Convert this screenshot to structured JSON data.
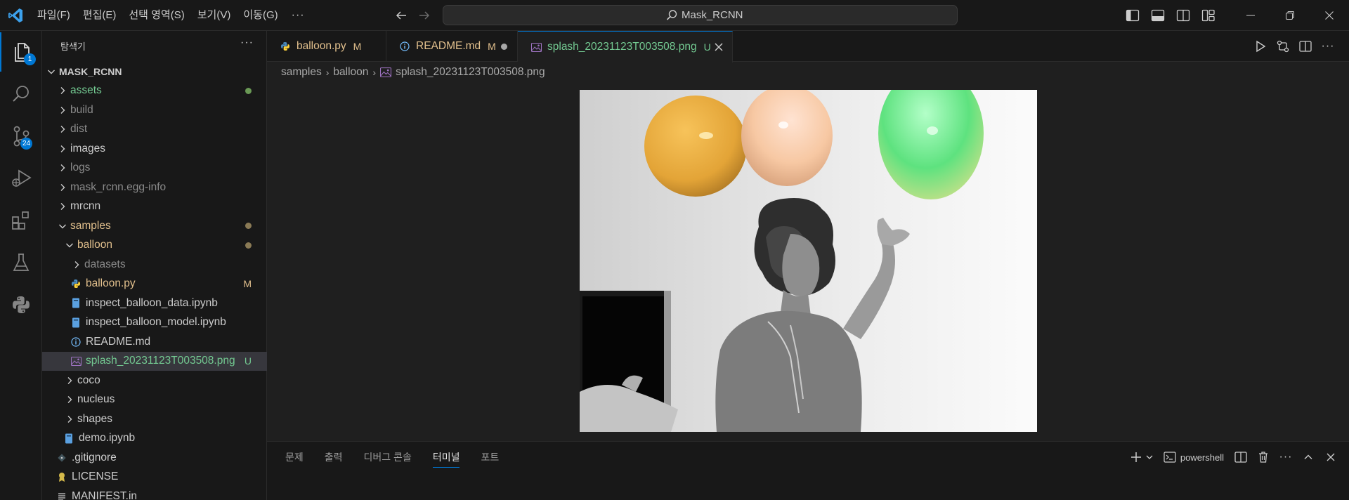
{
  "titlebar": {
    "menu": [
      "파일(F)",
      "편집(E)",
      "선택 영역(S)",
      "보기(V)",
      "이동(G)"
    ],
    "more": "···",
    "search_text": "Mask_RCNN"
  },
  "activity": {
    "explorer_badge": "1",
    "scm_badge": "24"
  },
  "sidebar": {
    "title": "탐색기",
    "more": "···",
    "root": "MASK_RCNN",
    "items": [
      {
        "label": "assets",
        "decoration": "",
        "dot": true
      },
      {
        "label": "build",
        "decoration": ""
      },
      {
        "label": "dist",
        "decoration": ""
      },
      {
        "label": "images",
        "decoration": ""
      },
      {
        "label": "logs",
        "decoration": ""
      },
      {
        "label": "mask_rcnn.egg-info",
        "decoration": ""
      },
      {
        "label": "mrcnn",
        "decoration": ""
      },
      {
        "label": "samples",
        "decoration": "",
        "dot": true
      },
      {
        "label": "balloon",
        "decoration": "",
        "dot": true
      },
      {
        "label": "datasets",
        "decoration": ""
      },
      {
        "label": "balloon.py",
        "decoration": "M"
      },
      {
        "label": "inspect_balloon_data.ipynb",
        "decoration": ""
      },
      {
        "label": "inspect_balloon_model.ipynb",
        "decoration": ""
      },
      {
        "label": "README.md",
        "decoration": ""
      },
      {
        "label": "splash_20231123T003508.png",
        "decoration": "U"
      },
      {
        "label": "coco",
        "decoration": ""
      },
      {
        "label": "nucleus",
        "decoration": ""
      },
      {
        "label": "shapes",
        "decoration": ""
      },
      {
        "label": "demo.ipynb",
        "decoration": ""
      },
      {
        "label": ".gitignore",
        "decoration": ""
      },
      {
        "label": "LICENSE",
        "decoration": ""
      },
      {
        "label": "MANIFEST.in",
        "decoration": ""
      }
    ]
  },
  "tabs": [
    {
      "label": "balloon.py",
      "mark": "M"
    },
    {
      "label": "README.md",
      "mark": "M"
    },
    {
      "label": "splash_20231123T003508.png",
      "mark": "U"
    }
  ],
  "breadcrumb": [
    "samples",
    "balloon",
    "splash_20231123T003508.png"
  ],
  "panel": {
    "tabs": [
      "문제",
      "출력",
      "디버그 콘솔",
      "터미널",
      "포트"
    ],
    "terminal_name": "powershell"
  },
  "colors": {
    "accent": "#0078d4",
    "untracked": "#73c991",
    "modified": "#e2c08d"
  }
}
